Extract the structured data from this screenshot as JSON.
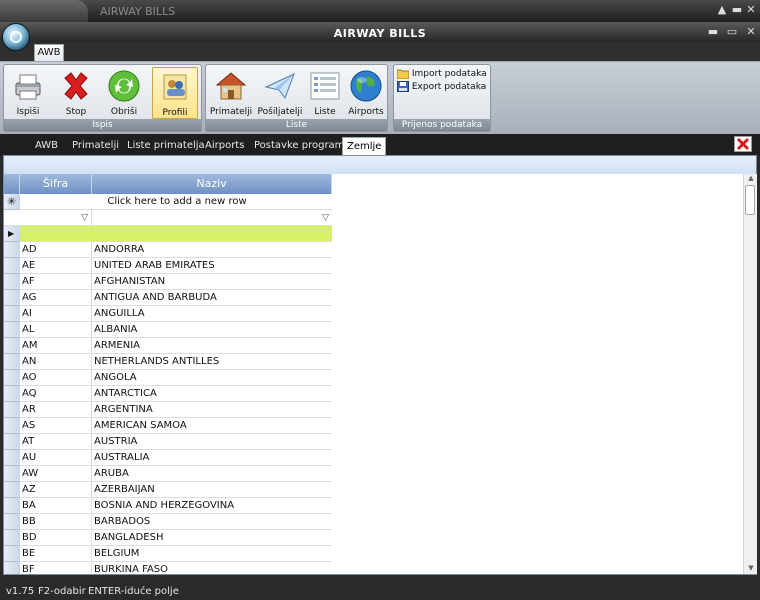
{
  "window": {
    "outer_title": "AIRWAY BILLS",
    "app_title": "AIRWAY BILLS"
  },
  "window_controls": {
    "minimize": "▬",
    "maximize": "▭",
    "close": "✕",
    "up": "▲"
  },
  "ribbon": {
    "tab": "AWB",
    "groups": [
      {
        "label": "Ispis",
        "buttons": [
          {
            "label": "Ispiši",
            "icon": "printer-icon"
          },
          {
            "label": "Stop",
            "icon": "stop-x-icon"
          },
          {
            "label": "Obriši",
            "icon": "refresh-icon"
          },
          {
            "label": "Profili",
            "icon": "profiles-icon"
          }
        ]
      },
      {
        "label": "Liste",
        "buttons": [
          {
            "label": "Primatelji",
            "icon": "house-icon"
          },
          {
            "label": "Pošiljatelji",
            "icon": "paper-plane-icon"
          },
          {
            "label": "Liste",
            "icon": "list-icon"
          },
          {
            "label": "Airports",
            "icon": "globe-icon"
          }
        ]
      },
      {
        "label": "Prijenos podataka",
        "buttons": [
          {
            "label": "Import podataka",
            "icon": "folder-icon"
          },
          {
            "label": "Export podataka",
            "icon": "save-icon"
          }
        ]
      }
    ]
  },
  "doc_tabs": [
    "AWB",
    "Primatelji",
    "Liste primatelja",
    "Airports",
    "Postavke programa",
    "Zemlje"
  ],
  "active_tab": "Zemlje",
  "grid": {
    "columns": [
      "Šifra",
      "Naziv"
    ],
    "new_row_text": "Click here to add a new row",
    "rows": [
      [
        "AD",
        "ANDORRA"
      ],
      [
        "AE",
        "UNITED ARAB EMIRATES"
      ],
      [
        "AF",
        "AFGHANISTAN"
      ],
      [
        "AG",
        "ANTIGUA AND BARBUDA"
      ],
      [
        "AI",
        "ANGUILLA"
      ],
      [
        "AL",
        "ALBANIA"
      ],
      [
        "AM",
        "ARMENIA"
      ],
      [
        "AN",
        "NETHERLANDS ANTILLES"
      ],
      [
        "AO",
        "ANGOLA"
      ],
      [
        "AQ",
        "ANTARCTICA"
      ],
      [
        "AR",
        "ARGENTINA"
      ],
      [
        "AS",
        "AMERICAN SAMOA"
      ],
      [
        "AT",
        "AUSTRIA"
      ],
      [
        "AU",
        "AUSTRALIA"
      ],
      [
        "AW",
        "ARUBA"
      ],
      [
        "AZ",
        "AZERBAIJAN"
      ],
      [
        "BA",
        "BOSNIA AND HERZEGOVINA"
      ],
      [
        "BB",
        "BARBADOS"
      ],
      [
        "BD",
        "BANGLADESH"
      ],
      [
        "BE",
        "BELGIUM"
      ],
      [
        "BF",
        "BURKINA FASO"
      ]
    ]
  },
  "status": {
    "version": "v1.75",
    "hint1": "F2-odabir",
    "hint2": "ENTER-iduće polje"
  },
  "colors": {
    "accent_row": "#d7f06a",
    "header": "#7a9bcb"
  }
}
